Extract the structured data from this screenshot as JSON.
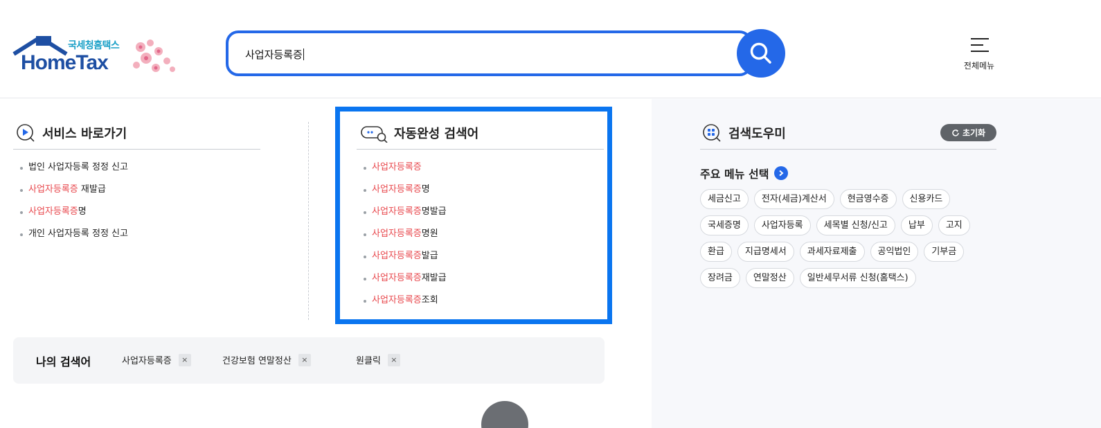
{
  "header": {
    "logo": {
      "sub": "국세청홈택스",
      "main": "HomeTax"
    },
    "search": {
      "value": "사업자등록증"
    },
    "all_menu_label": "전체메뉴"
  },
  "quick": {
    "title": "서비스 바로가기",
    "items": [
      {
        "pre": "",
        "hl": "",
        "post": "법인 사업자등록 정정 신고"
      },
      {
        "pre": "",
        "hl": "사업자등록증",
        "post": " 재발급"
      },
      {
        "pre": "",
        "hl": "사업자등록증",
        "post": "명"
      },
      {
        "pre": "",
        "hl": "",
        "post": "개인 사업자등록 정정 신고"
      }
    ]
  },
  "autocomplete": {
    "title": "자동완성 검색어",
    "items": [
      {
        "hl": "사업자등록증",
        "post": ""
      },
      {
        "hl": "사업자등록증",
        "post": "명"
      },
      {
        "hl": "사업자등록증",
        "post": "명발급"
      },
      {
        "hl": "사업자등록증",
        "post": "명원"
      },
      {
        "hl": "사업자등록증",
        "post": "발급"
      },
      {
        "hl": "사업자등록증",
        "post": "재발급"
      },
      {
        "hl": "사업자등록증",
        "post": "조회"
      }
    ]
  },
  "helper": {
    "title": "검색도우미",
    "reset_label": "초기화",
    "menu_select_label": "주요 메뉴 선택",
    "chip_rows": [
      [
        "세금신고",
        "전자(세금)계산서",
        "현금영수증",
        "신용카드"
      ],
      [
        "국세증명",
        "사업자등록",
        "세목별 신청/신고",
        "납부",
        "고지"
      ],
      [
        "환급",
        "지급명세서",
        "과세자료제출",
        "공익법인",
        "기부금"
      ],
      [
        "장려금",
        "연말정산",
        "일반세무서류 신청(홈택스)"
      ]
    ]
  },
  "my_search": {
    "title": "나의 검색어",
    "items": [
      "사업자등록증",
      "건강보험 연말정산",
      "원클릭"
    ],
    "remove_glyph": "×"
  },
  "colors": {
    "accent": "#2468e8",
    "highlight": "#e8474c",
    "frame": "#0a75f0"
  }
}
